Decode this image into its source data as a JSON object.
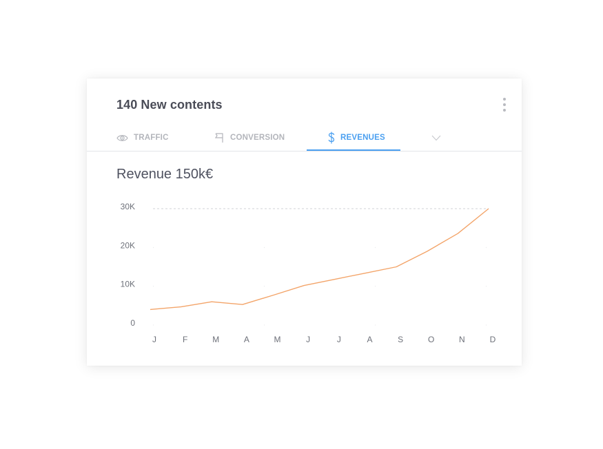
{
  "card": {
    "title": "140 New contents",
    "menu_icon": "more-vertical-icon"
  },
  "tabs": [
    {
      "label": "TRAFFIC",
      "icon": "eye-icon",
      "active": false
    },
    {
      "label": "CONVERSION",
      "icon": "flag-icon",
      "active": false
    },
    {
      "label": "REVENUES",
      "icon": "dollar-icon",
      "active": true
    }
  ],
  "tabs_more_icon": "chevron-down-icon",
  "colors": {
    "accent": "#4a9ff0",
    "line": "#f3a469",
    "muted": "#b3b5bb",
    "title": "#4a4c57"
  },
  "chart_data": {
    "type": "line",
    "title": "Revenue 150k€",
    "xlabel": "",
    "ylabel": "",
    "categories": [
      "J",
      "F",
      "M",
      "A",
      "M",
      "J",
      "J",
      "A",
      "S",
      "O",
      "N",
      "D"
    ],
    "series": [
      {
        "name": "Revenue",
        "values": [
          4000,
          4700,
          6000,
          5300,
          7700,
          10200,
          11800,
          13400,
          15000,
          19000,
          23600,
          30000
        ]
      }
    ],
    "yticks": [
      {
        "value": 0,
        "label": "0"
      },
      {
        "value": 10000,
        "label": "10K"
      },
      {
        "value": 20000,
        "label": "20K"
      },
      {
        "value": 30000,
        "label": "30K"
      }
    ],
    "ylim": [
      0,
      30000
    ],
    "grid": "dotted",
    "max_reference_line": 30000,
    "legend": "none"
  }
}
